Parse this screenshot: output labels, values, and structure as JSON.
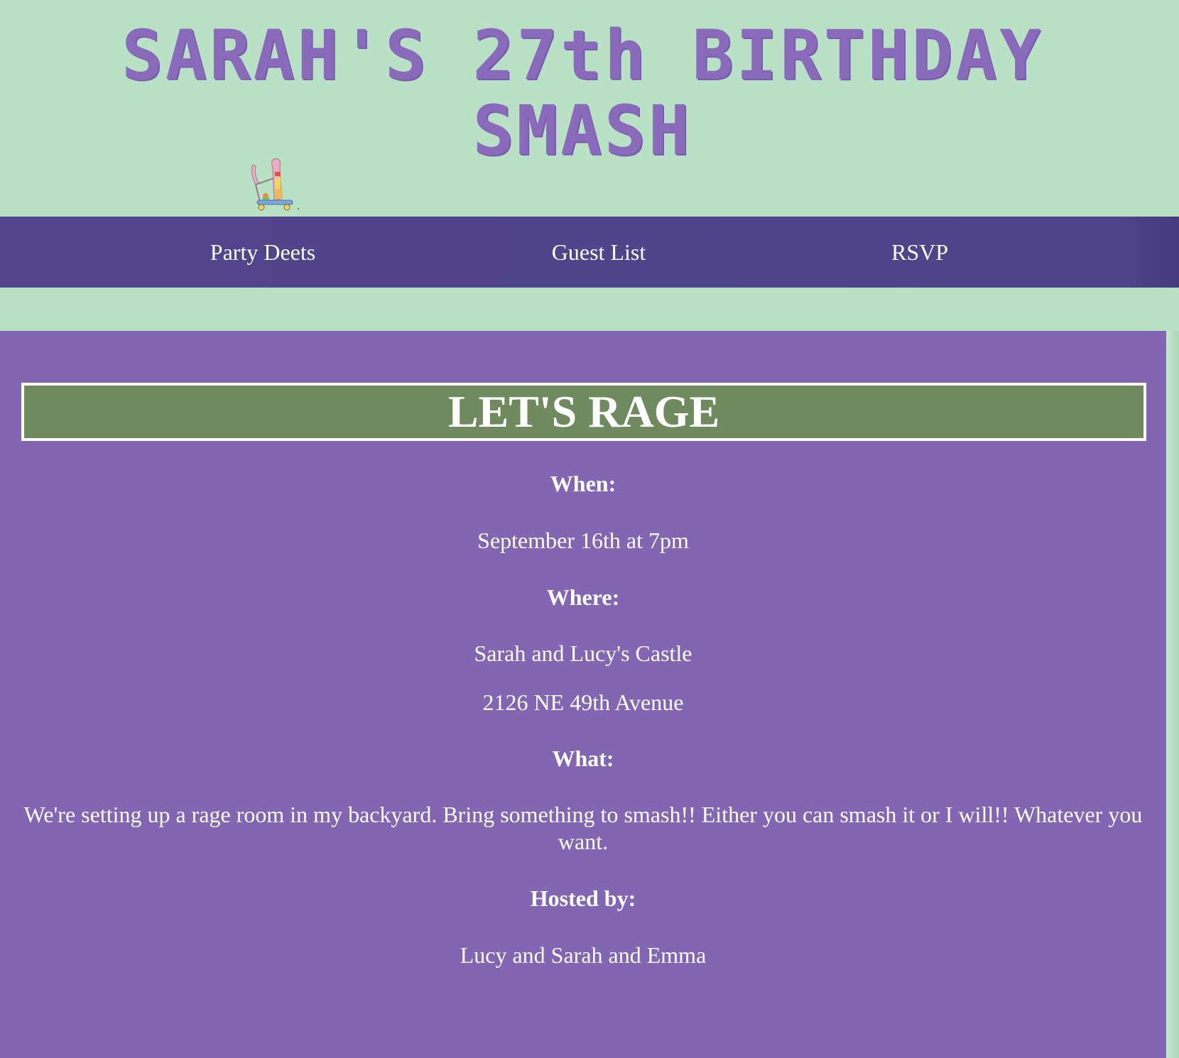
{
  "header": {
    "title": "SARAH'S 27th BIRTHDAY SMASH",
    "logo_icon": "scooter-icon"
  },
  "nav": {
    "items": [
      {
        "label": "Party Deets"
      },
      {
        "label": "Guest List"
      },
      {
        "label": "RSVP"
      }
    ]
  },
  "main": {
    "banner": "LET'S RAGE",
    "when_label": "When:",
    "when_value": "September 16th at 7pm",
    "where_label": "Where:",
    "where_place": "Sarah and Lucy's Castle",
    "where_address": "2126 NE 49th Avenue",
    "what_label": "What:",
    "what_value": "We're setting up a rage room in my backyard. Bring something to smash!! Either you can smash it or I will!! Whatever you want.",
    "hosted_label": "Hosted by:",
    "hosted_value": "Lucy and Sarah and Emma"
  },
  "colors": {
    "page_bg": "#b9e1c6",
    "title": "#8a6bbb",
    "nav_bg": "#52458e",
    "content_bg": "#8266b3",
    "banner_bg": "#6f8a5f"
  }
}
